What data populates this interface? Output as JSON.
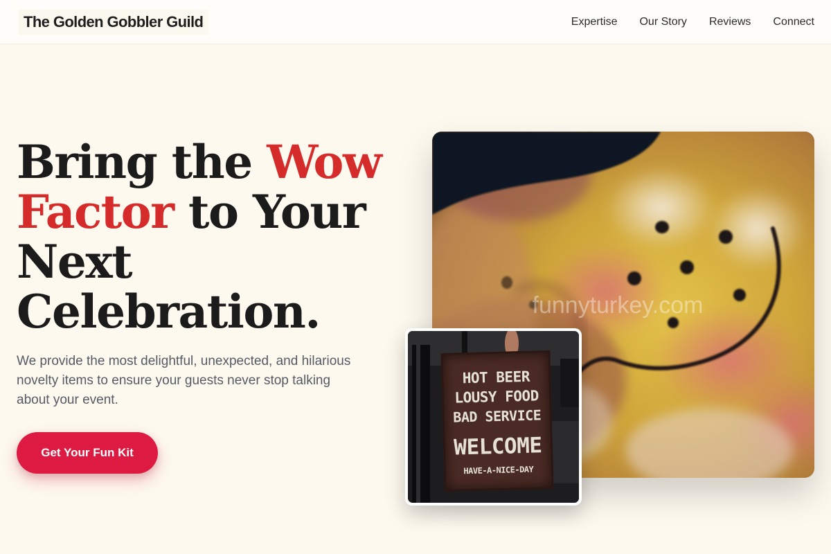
{
  "brand": {
    "name": "The Golden Gobbler Guild"
  },
  "nav": {
    "items": [
      {
        "label": "Expertise"
      },
      {
        "label": "Our Story"
      },
      {
        "label": "Reviews"
      },
      {
        "label": "Connect"
      }
    ]
  },
  "hero": {
    "headline_part1": "Bring the ",
    "headline_accent1": "Wow",
    "headline_accent2": "Factor",
    "headline_part2": " to Your Next Celebration.",
    "subtext": "We provide the most delightful, unexpected, and hilarious novelty items to ensure your guests never stop talking about your event.",
    "cta_label": "Get Your Fun Kit"
  },
  "images": {
    "main_watermark": "funnyturkey.com",
    "sign": {
      "line1": "HOT BEER",
      "line2": "LOUSY FOOD",
      "line3": "BAD SERVICE",
      "line4": "WELCOME",
      "line5": "HAVE-A-NICE-DAY"
    }
  },
  "colors": {
    "accent_red": "#d62b2b",
    "cta_background": "#dd1a41",
    "page_background": "#fdf9ef"
  }
}
